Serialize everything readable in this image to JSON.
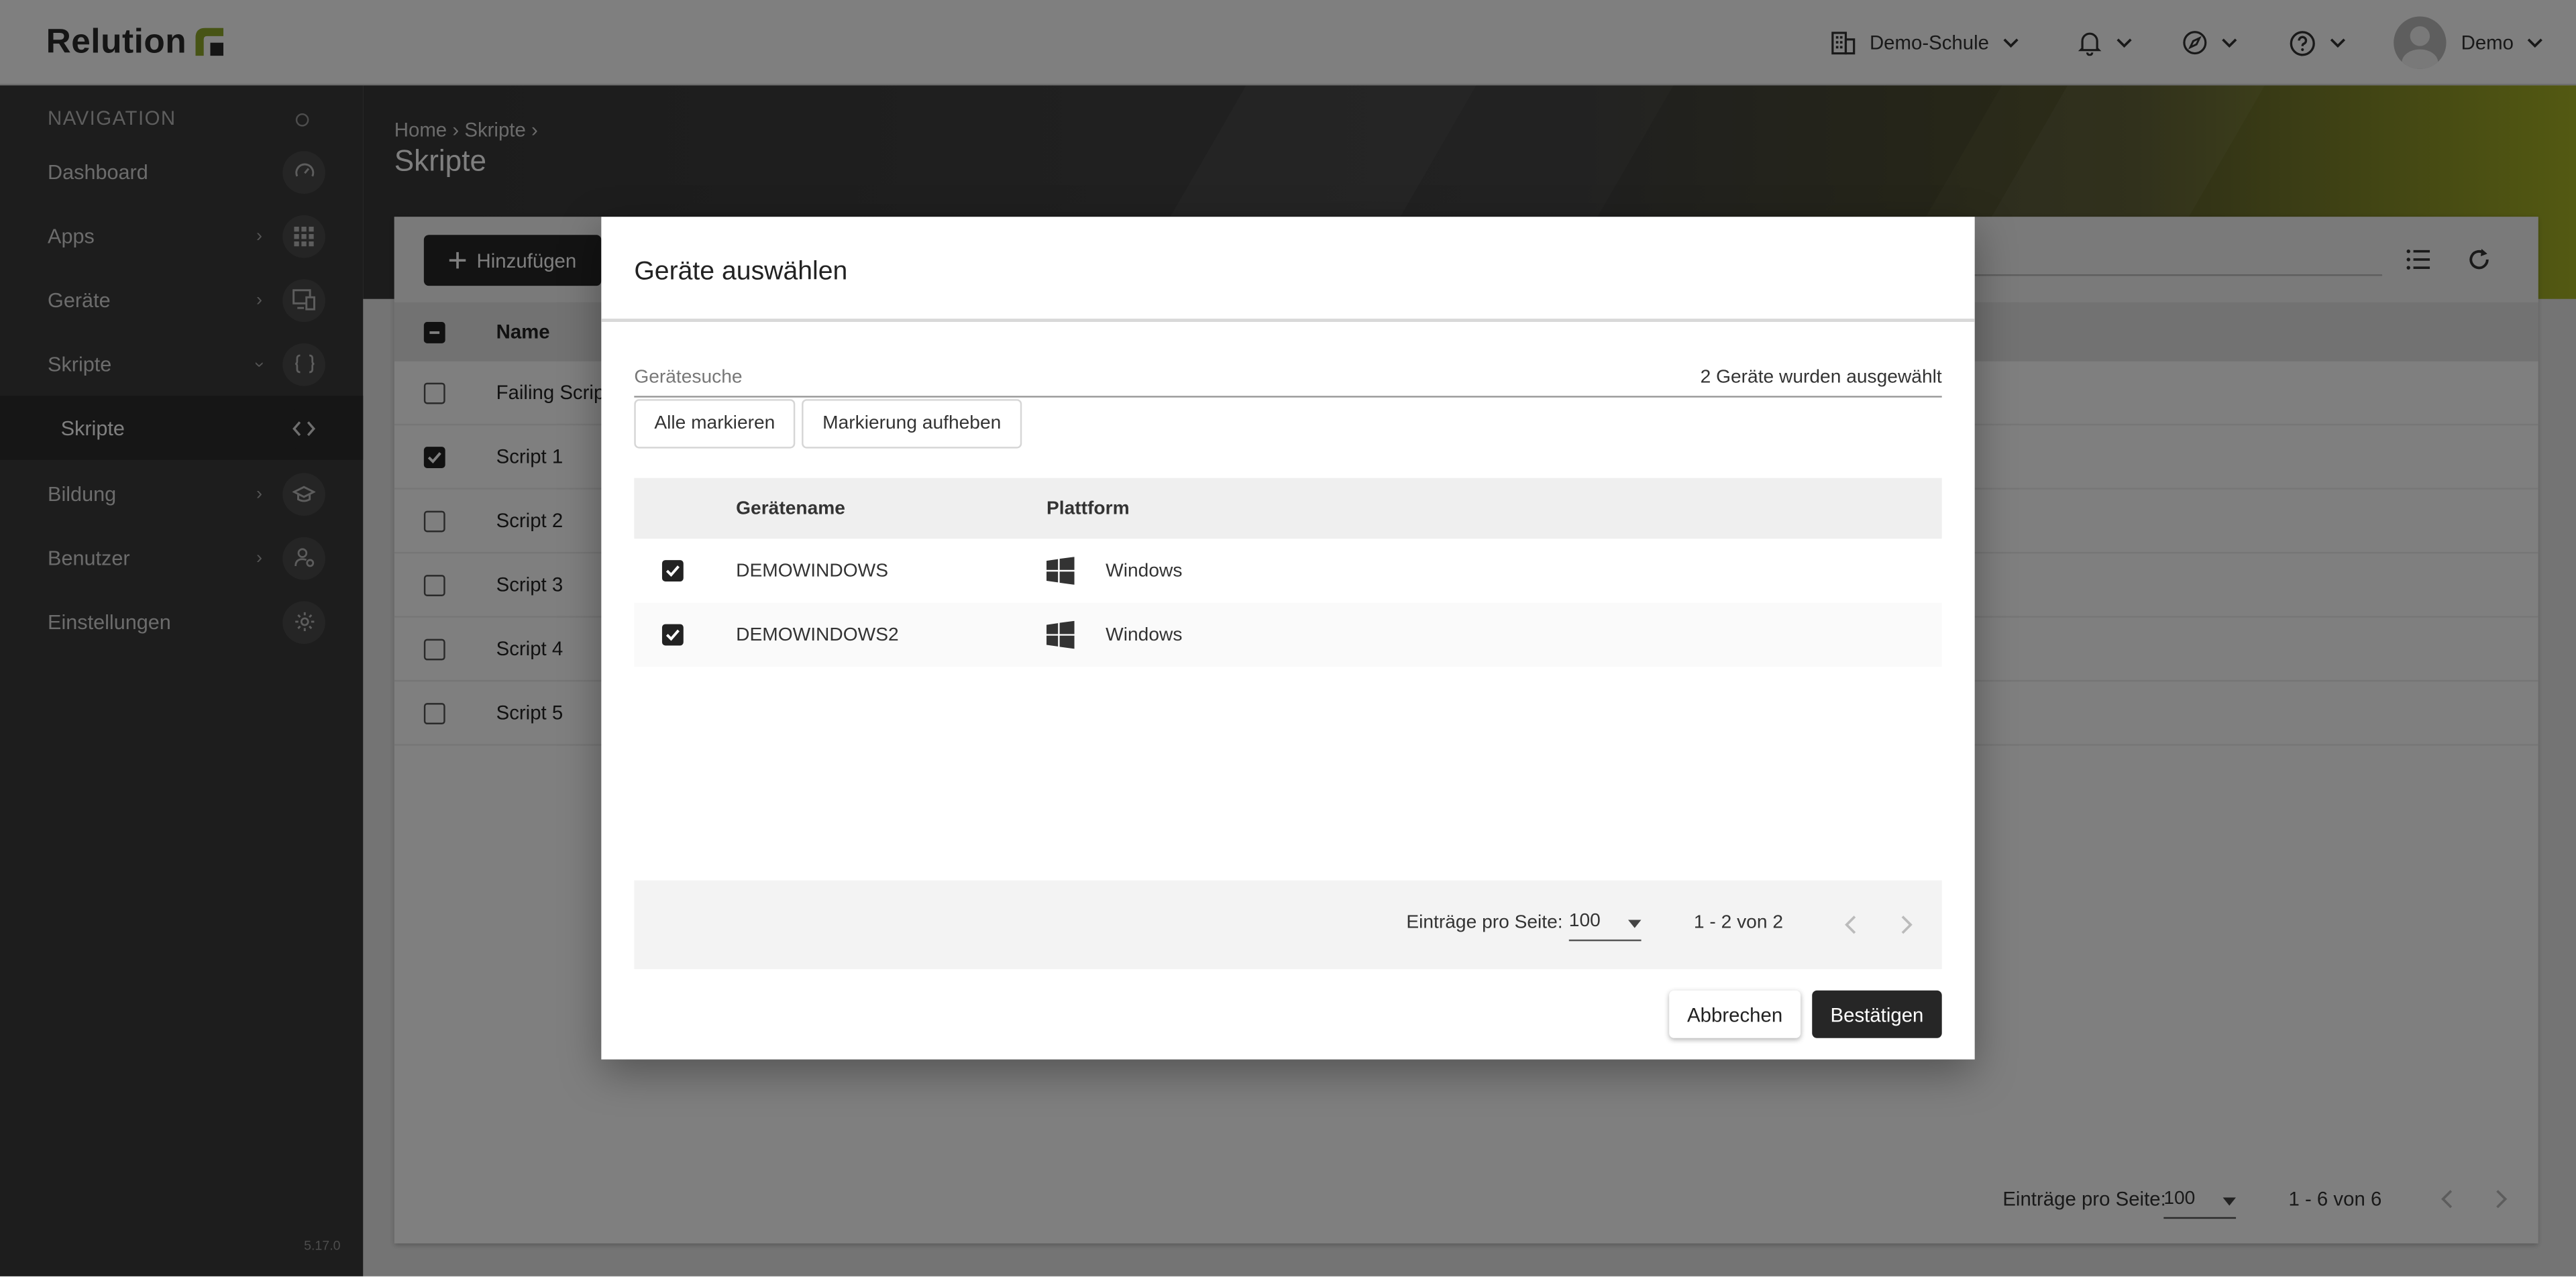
{
  "app": {
    "brand": "Relution"
  },
  "topbar": {
    "tenant": "Demo-Schule",
    "user": "Demo",
    "icons": [
      "building-icon",
      "bell-icon",
      "compass-icon",
      "help-icon"
    ]
  },
  "sidebar": {
    "header": "NAVIGATION",
    "items": [
      {
        "label": "Dashboard"
      },
      {
        "label": "Apps"
      },
      {
        "label": "Geräte"
      },
      {
        "label": "Skripte"
      },
      {
        "label": "Skripte"
      },
      {
        "label": "Bildung"
      },
      {
        "label": "Benutzer"
      },
      {
        "label": "Einstellungen"
      }
    ],
    "version": "5.17.0"
  },
  "page": {
    "breadcrumb": [
      "Home",
      "Skripte"
    ],
    "title": "Skripte",
    "add_label": "Hinzufügen",
    "column_name": "Name",
    "rows": [
      "Failing Script",
      "Script 1",
      "Script 2",
      "Script 3",
      "Script 4",
      "Script 5"
    ],
    "rows_checked": [
      false,
      true,
      false,
      false,
      false,
      false
    ],
    "per_page_label": "Einträge pro Seite:",
    "per_page_value": "100",
    "range": "1 - 6 von 6"
  },
  "modal": {
    "title": "Geräte auswählen",
    "search_label": "Gerätesuche",
    "selected_count": "2 Geräte wurden ausgewählt",
    "select_all": "Alle markieren",
    "deselect": "Markierung aufheben",
    "col_name": "Gerätename",
    "col_platform": "Plattform",
    "devices": [
      {
        "name": "DEMOWINDOWS",
        "platform": "Windows",
        "checked": true
      },
      {
        "name": "DEMOWINDOWS2",
        "platform": "Windows",
        "checked": true
      }
    ],
    "per_page_label": "Einträge pro Seite:",
    "per_page_value": "100",
    "range": "1 - 2 von 2",
    "cancel": "Abbrechen",
    "confirm": "Bestätigen"
  }
}
